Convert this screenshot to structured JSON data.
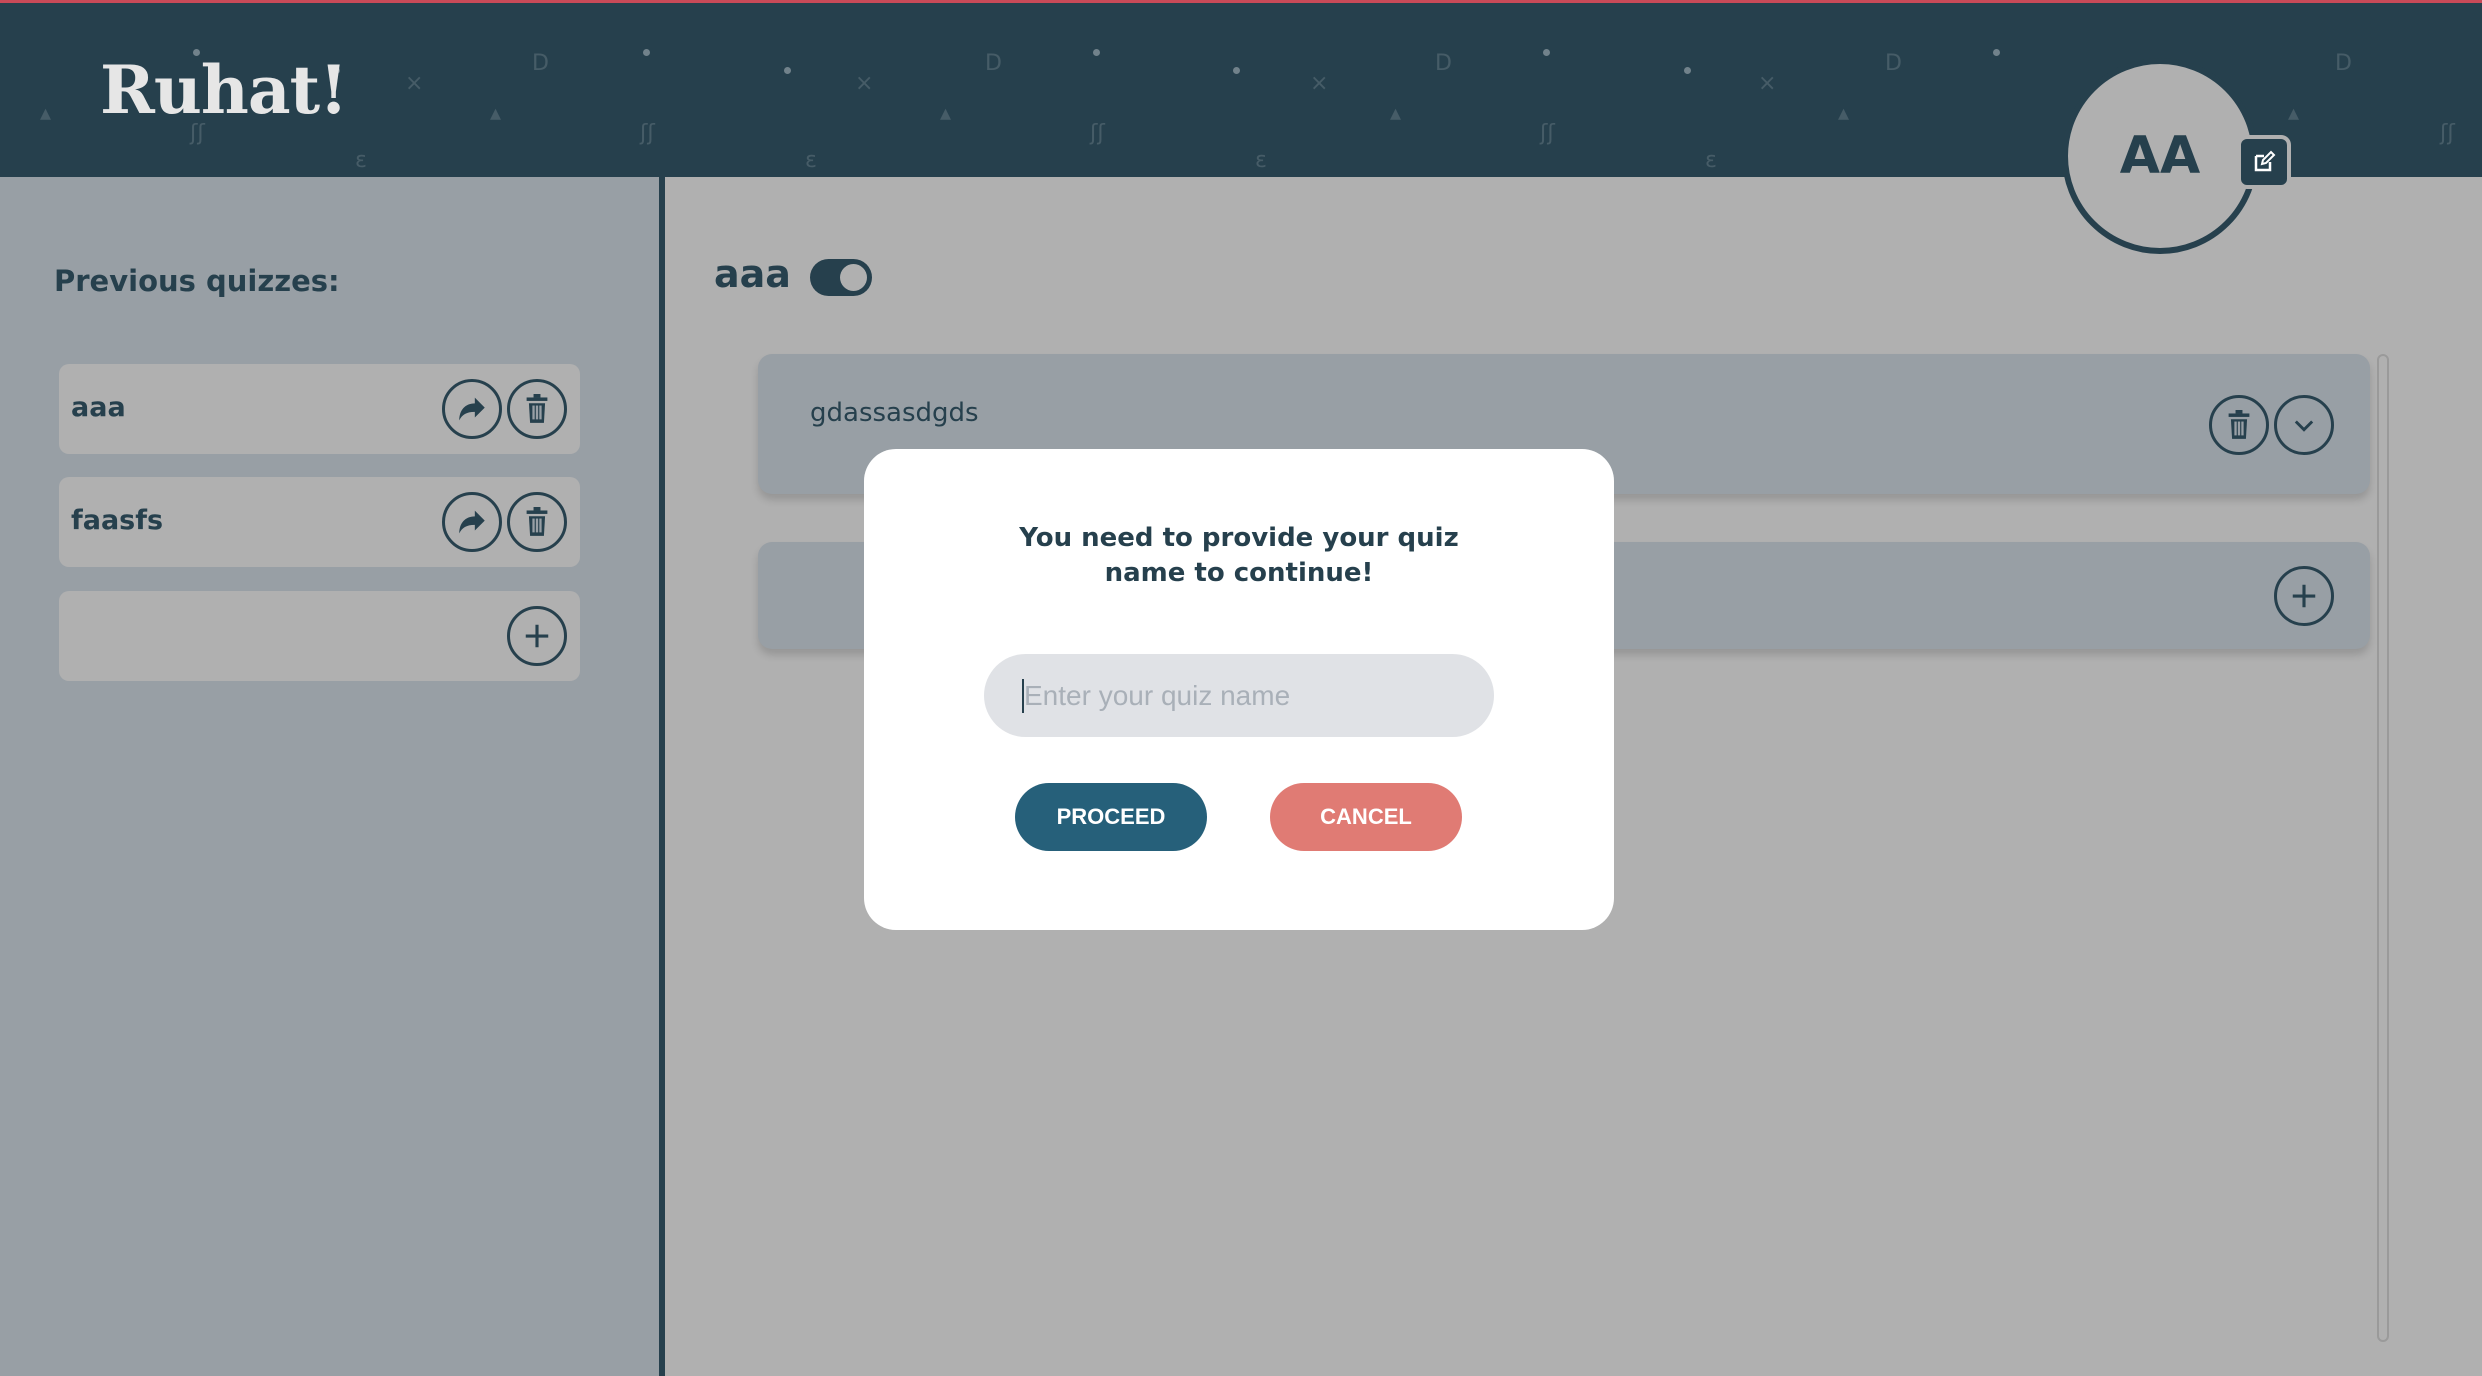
{
  "colors": {
    "header": "#26404d",
    "accent_border": "#c94a58",
    "sidebar": "#989fa5",
    "main": "#b0b0b0",
    "proceed": "#26607a",
    "cancel": "#e07b74"
  },
  "header": {
    "logo": "Ruhat!"
  },
  "profile": {
    "initials": "AA",
    "edit_icon": "edit-icon"
  },
  "sidebar": {
    "title": "Previous quizzes:",
    "items": [
      {
        "name": "aaa",
        "share_icon": "share-icon",
        "delete_icon": "trash-icon"
      },
      {
        "name": "faasfs",
        "share_icon": "share-icon",
        "delete_icon": "trash-icon"
      }
    ],
    "add_icon": "plus-icon"
  },
  "main": {
    "quiz_title": "aaa",
    "toggle_on": true,
    "questions": [
      {
        "text": "gdassasdgds"
      }
    ]
  },
  "modal": {
    "message": "You need to provide your quiz name to continue!",
    "input_placeholder": "Enter your quiz name",
    "input_value": "",
    "proceed_label": "PROCEED",
    "cancel_label": "CANCEL"
  }
}
